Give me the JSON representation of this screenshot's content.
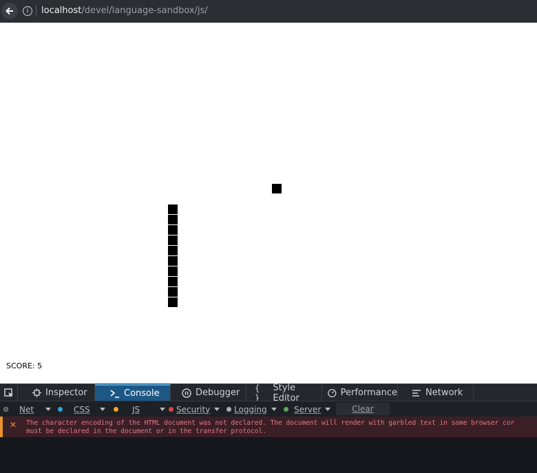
{
  "browser": {
    "url_host": "localhost",
    "url_path": "/devel/language-sandbox/js/",
    "back_icon": "back-arrow-icon",
    "info_icon": "info-icon"
  },
  "game": {
    "score_text": "SCORE: 5"
  },
  "devtools": {
    "tabs": [
      {
        "label": "Inspector",
        "icon": "inspector-icon"
      },
      {
        "label": "Console",
        "icon": "console-prompt-icon",
        "selected": true
      },
      {
        "label": "Debugger",
        "icon": "pause-icon"
      },
      {
        "label": "Style Editor",
        "icon": "braces-icon"
      },
      {
        "label": "Performance",
        "icon": "gauge-icon"
      },
      {
        "label": "Network",
        "icon": "network-list-icon"
      }
    ],
    "filters": [
      {
        "label": "Net",
        "color": "#4c4f54"
      },
      {
        "label": "CSS",
        "color": "#2ea4e0"
      },
      {
        "label": "JS",
        "color": "#f7a52b"
      },
      {
        "label": "Security",
        "color": "#e0424d"
      },
      {
        "label": "Logging",
        "color": "#a9b0b8"
      },
      {
        "label": "Server",
        "color": "#58a45c"
      }
    ],
    "clear_label": "Clear",
    "message": {
      "line1": "The character encoding of the HTML document was not declared. The document will render with garbled text in some browser cor",
      "line2": "must be declared in the document or in the transfer protocol."
    }
  },
  "colors": {
    "accent": "#1c5785",
    "warning": "#e8932c",
    "error_text": "#e1778a"
  }
}
